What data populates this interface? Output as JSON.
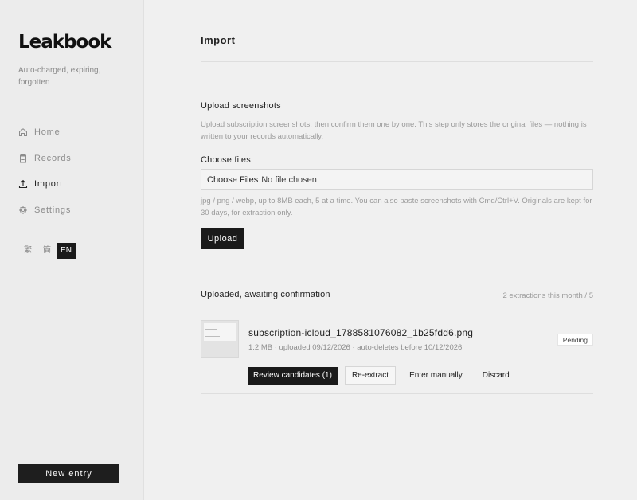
{
  "sidebar": {
    "brand": "Leakbook",
    "tagline": "Auto-charged, expiring, forgotten",
    "nav": [
      {
        "label": "Home",
        "icon": "home-icon"
      },
      {
        "label": "Records",
        "icon": "clipboard-icon"
      },
      {
        "label": "Import",
        "icon": "upload-icon",
        "active": true
      },
      {
        "label": "Settings",
        "icon": "gear-icon"
      }
    ],
    "languages": [
      "繁",
      "簡",
      "EN"
    ],
    "selected_language": "EN",
    "new_entry_label": "New entry"
  },
  "main": {
    "title": "Import",
    "upload_section": {
      "heading": "Upload screenshots",
      "description": "Upload subscription screenshots, then confirm them one by one. This step only stores the original files — nothing is written to your records automatically.",
      "choose_label": "Choose files",
      "file_button": "Choose Files",
      "file_status": "No file chosen",
      "hint": "jpg / png / webp, up to 8MB each, 5 at a time. You can also paste screenshots with Cmd/Ctrl+V. Originals are kept for 30 days, for extraction only.",
      "upload_label": "Upload"
    },
    "pending_section": {
      "heading": "Uploaded, awaiting confirmation",
      "counter": "2 extractions this month / 5",
      "items": [
        {
          "filename": "subscription-icloud_1788581076082_1b25fdd6.png",
          "meta": "1.2 MB · uploaded 09/12/2026 · auto-deletes before 10/12/2026",
          "status": "Pending",
          "actions": {
            "review": "Review candidates (1)",
            "reextract": "Re-extract",
            "manual": "Enter manually",
            "discard": "Discard"
          }
        }
      ]
    }
  }
}
